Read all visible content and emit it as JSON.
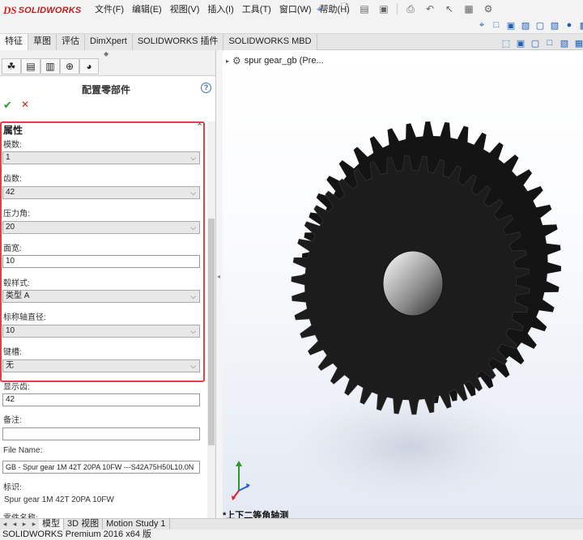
{
  "app": {
    "logo_ds": "DS",
    "logo_brand": "SOLIDWORKS"
  },
  "menu": {
    "items": [
      "文件(F)",
      "编辑(E)",
      "视图(V)",
      "插入(I)",
      "工具(T)",
      "窗口(W)",
      "帮助(H)"
    ]
  },
  "ribbon_tabs": [
    "特征",
    "草图",
    "评估",
    "DimXpert",
    "SOLIDWORKS 插件",
    "SOLIDWORKS MBD"
  ],
  "property_manager": {
    "title": "配置零部件",
    "ok_label": "✔",
    "cancel_label": "✕",
    "section_title": "属性",
    "fields": {
      "module_label": "模数:",
      "module_value": "1",
      "teeth_label": "齿数:",
      "teeth_value": "42",
      "pressure_label": "压力角:",
      "pressure_value": "20",
      "face_label": "面宽:",
      "face_value": "10",
      "hub_label": "毂样式:",
      "hub_value": "类型 A",
      "bore_label": "标称轴直径:",
      "bore_value": "10",
      "keyway_label": "键槽:",
      "keyway_value": "无",
      "display_label": "显示齿:",
      "display_value": "42",
      "comment_label": "备注:",
      "comment_value": "",
      "filename_label": "File Name:",
      "filename_value": "GB - Spur gear 1M 42T 20PA 10FW ---S42A75H50L10.0N",
      "identifier_label": "标识:",
      "identifier_value": "Spur gear 1M 42T 20PA 10FW",
      "partname_label": "零件名称:"
    }
  },
  "viewport": {
    "tree_item": "spur gear_gb  (Pre...",
    "view_name": "*上下二等角轴测"
  },
  "bottom_tabs": [
    "模型",
    "3D 视图",
    "Motion Study 1"
  ],
  "status": "SOLIDWORKS Premium 2016 x64 版",
  "colors": {
    "accent_red": "#e04040",
    "gear_dark": "#1c1c1c"
  },
  "gear": {
    "teeth": 42
  }
}
